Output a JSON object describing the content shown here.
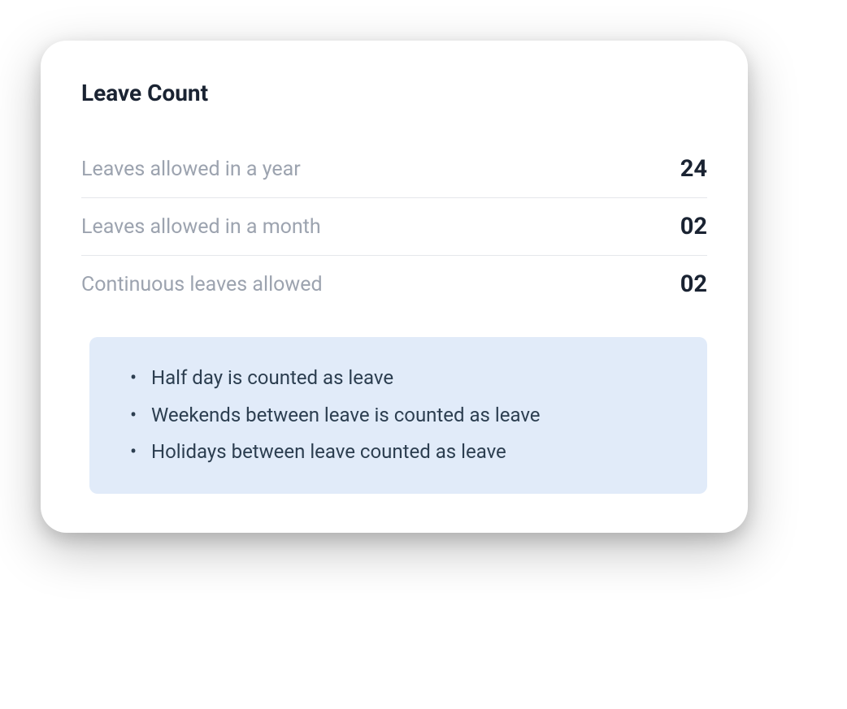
{
  "card": {
    "title": "Leave Count",
    "rows": [
      {
        "label": "Leaves allowed  in a year",
        "value": "24"
      },
      {
        "label": "Leaves allowed  in a month",
        "value": "02"
      },
      {
        "label": "Continuous leaves allowed",
        "value": "02"
      }
    ],
    "notes": [
      "Half day is counted as leave",
      "Weekends between leave is counted as leave",
      "Holidays between leave counted as leave"
    ]
  }
}
